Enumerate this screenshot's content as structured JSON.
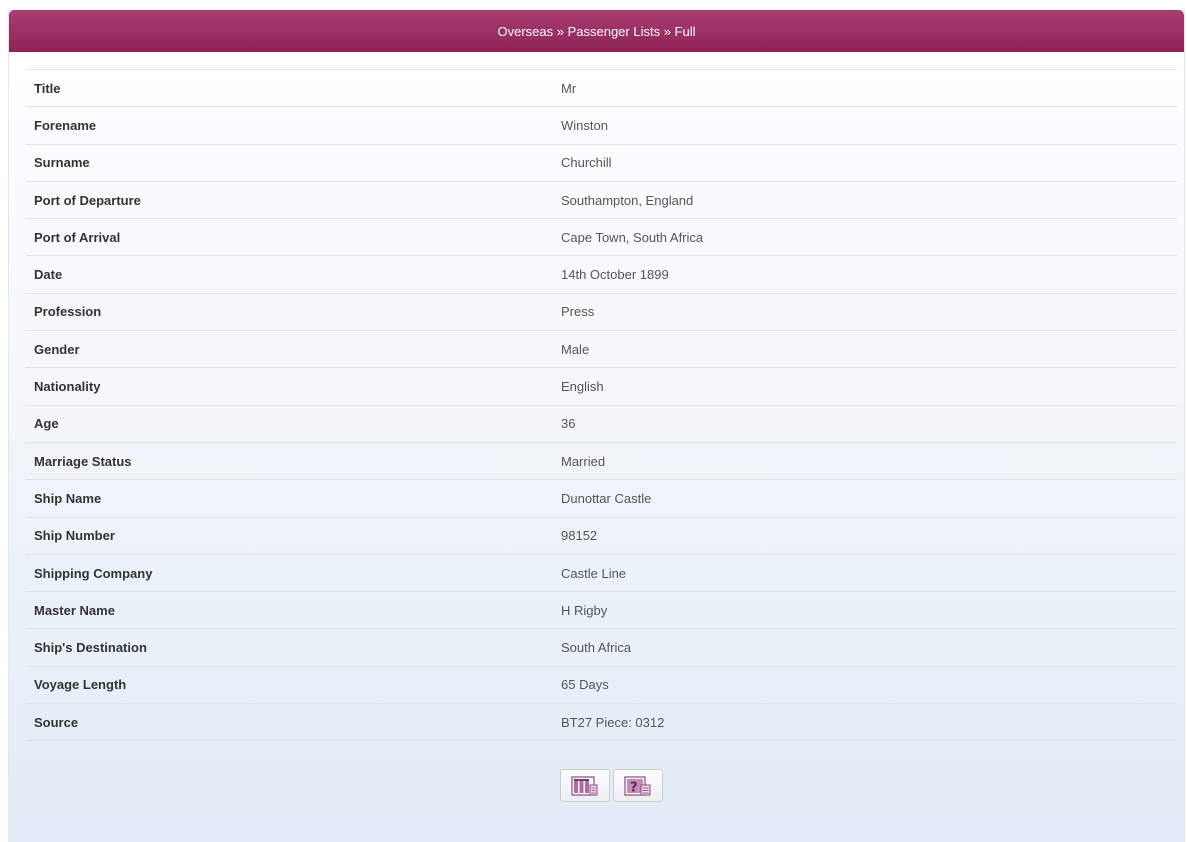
{
  "header": {
    "breadcrumb": "Overseas » Passenger Lists » Full"
  },
  "rows": [
    {
      "label": "Title",
      "value": "Mr"
    },
    {
      "label": "Forename",
      "value": "Winston"
    },
    {
      "label": "Surname",
      "value": "Churchill"
    },
    {
      "label": "Port of Departure",
      "value": "Southampton, England"
    },
    {
      "label": "Port of Arrival",
      "value": "Cape Town, South Africa"
    },
    {
      "label": "Date",
      "value": "14th October 1899"
    },
    {
      "label": "Profession",
      "value": "Press"
    },
    {
      "label": "Gender",
      "value": "Male"
    },
    {
      "label": "Nationality",
      "value": "English"
    },
    {
      "label": "Age",
      "value": "36"
    },
    {
      "label": "Marriage Status",
      "value": "Married"
    },
    {
      "label": "Ship Name",
      "value": "Dunottar Castle"
    },
    {
      "label": "Ship Number",
      "value": "98152"
    },
    {
      "label": "Shipping Company",
      "value": "Castle Line"
    },
    {
      "label": "Master Name",
      "value": "H Rigby"
    },
    {
      "label": "Ship's Destination",
      "value": "South Africa"
    },
    {
      "label": "Voyage Length",
      "value": "65 Days"
    },
    {
      "label": "Source",
      "value": "BT27 Piece: 0312"
    }
  ],
  "actions": {
    "buttons": [
      {
        "icon": "document-columns-icon"
      },
      {
        "icon": "help-document-icon"
      }
    ]
  },
  "colors": {
    "header_top": "#a93c72",
    "header_bottom": "#8d2455",
    "icon_purple": "#9b4f8e"
  }
}
